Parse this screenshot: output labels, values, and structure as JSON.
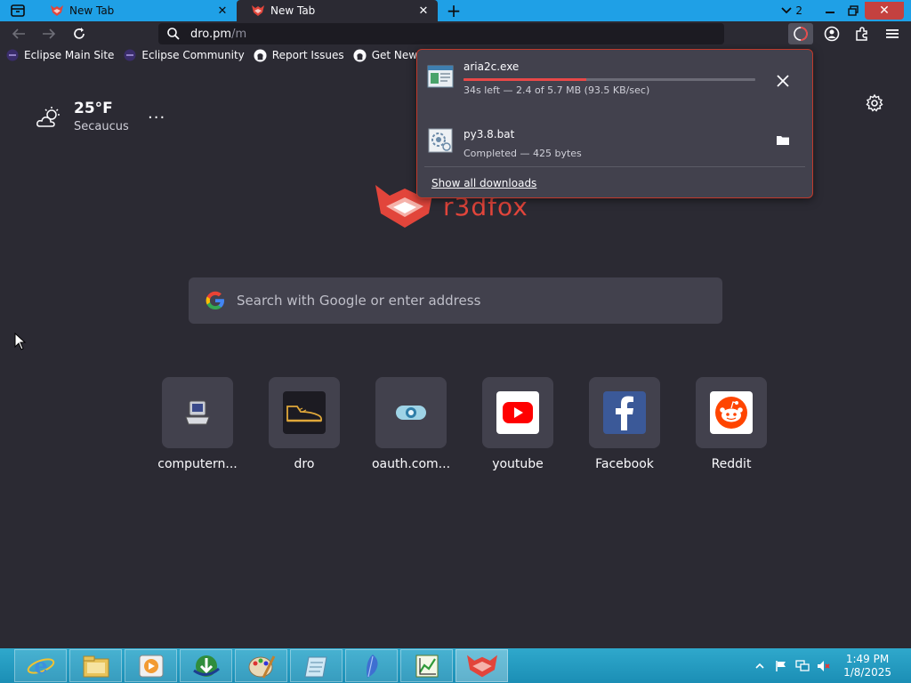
{
  "browser": {
    "tabs": [
      {
        "title": "New Tab",
        "active": false
      },
      {
        "title": "New Tab",
        "active": true
      }
    ],
    "container_count": "2",
    "url": {
      "host": "dro.pm",
      "path": "/m"
    },
    "bookmarks": [
      {
        "label": "Eclipse Main Site",
        "icon": "eclipse-icon"
      },
      {
        "label": "Eclipse Community",
        "icon": "eclipse-icon"
      },
      {
        "label": "Report Issues",
        "icon": "github-icon"
      },
      {
        "label": "Get New Releases",
        "icon": "github-icon"
      }
    ]
  },
  "weather": {
    "temperature": "25°F",
    "location": "Secaucus",
    "menu": "...",
    "icon": "partly-cloudy-icon"
  },
  "logo": {
    "text": "r3dfox"
  },
  "search": {
    "placeholder": "Search with Google or enter address"
  },
  "top_sites": [
    {
      "label": "computern...",
      "icon": "computer-icon"
    },
    {
      "label": "dro",
      "icon": "sneaker-icon"
    },
    {
      "label": "oauth.com...",
      "icon": "oauth-icon"
    },
    {
      "label": "youtube",
      "icon": "youtube-icon"
    },
    {
      "label": "Facebook",
      "icon": "facebook-icon"
    },
    {
      "label": "Reddit",
      "icon": "reddit-icon"
    }
  ],
  "downloads": {
    "items": [
      {
        "name": "aria2c.exe",
        "status": "34s left — 2.4 of 5.7 MB (93.5 KB/sec)",
        "progress": 0.42,
        "action": "cancel"
      },
      {
        "name": "py3.8.bat",
        "status": "Completed — 425 bytes",
        "action": "open-folder"
      }
    ],
    "show_all_label": "Show all downloads"
  },
  "taskbar": {
    "apps": [
      "internet-explorer-icon",
      "file-explorer-icon",
      "media-player-icon",
      "download-manager-icon",
      "paint-icon",
      "notepad-icon",
      "feather-icon",
      "chart-app-icon",
      "r3dfox-icon"
    ],
    "clock_time": "1:49 PM",
    "clock_date": "1/8/2025"
  },
  "colors": {
    "accent": "#1fa0e6",
    "brand_red": "#e2453b",
    "background": "#2b2a33"
  }
}
